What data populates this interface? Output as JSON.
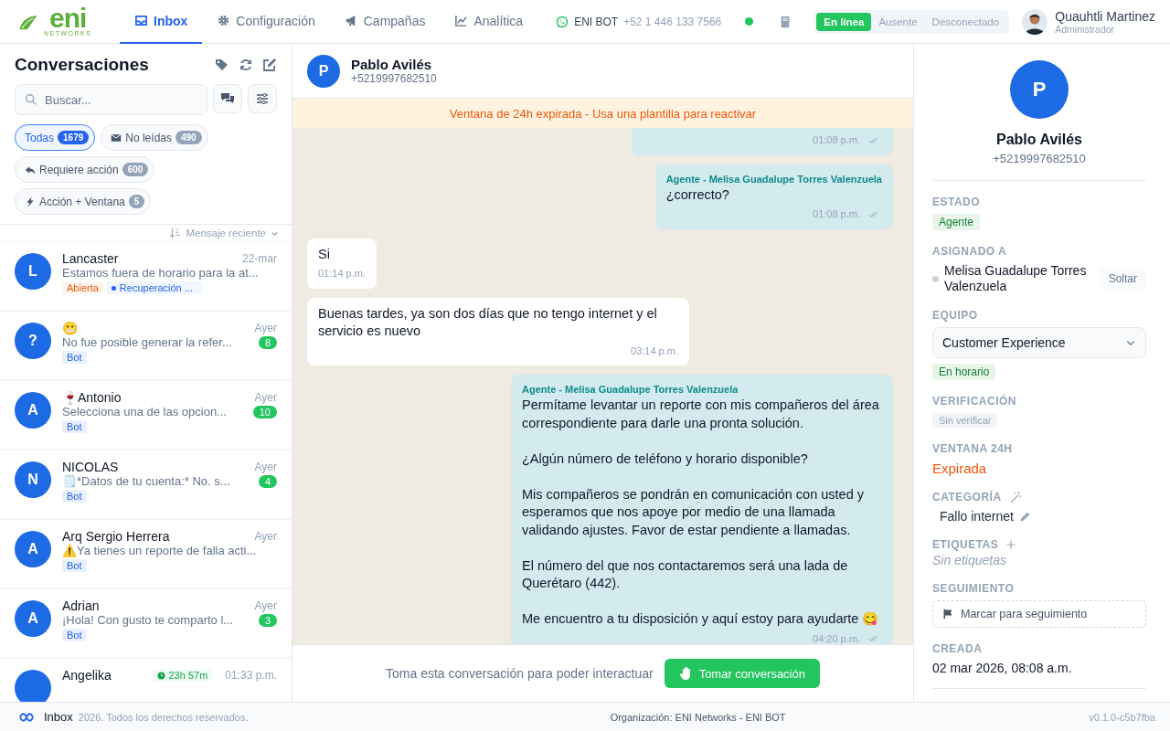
{
  "nav": {
    "logo": {
      "text": "eni",
      "subtitle": "NETWORKS"
    },
    "tabs": [
      {
        "label": "Inbox",
        "kind": "inbox",
        "selected": true
      },
      {
        "label": "Configuración",
        "kind": "settings",
        "selected": false
      },
      {
        "label": "Campañas",
        "kind": "campaigns",
        "selected": false
      },
      {
        "label": "Analítica",
        "kind": "analytics",
        "selected": false
      }
    ],
    "channel": {
      "name": "ENI BOT",
      "phone": "+52 1 446 133 7566",
      "connected": true
    },
    "presence": [
      {
        "label": "En línea",
        "selected": true
      },
      {
        "label": "Ausente",
        "selected": false
      },
      {
        "label": "Desconectado",
        "selected": false
      }
    ],
    "user": {
      "name": "Quauhtli Martinez",
      "role": "Administrador"
    }
  },
  "sidebar": {
    "title": "Conversaciones",
    "search_placeholder": "Buscar...",
    "filters": [
      {
        "label": "Todas",
        "count": "1679",
        "kind": "all",
        "selected": true
      },
      {
        "label": "No leídas",
        "count": "490",
        "kind": "unread",
        "selected": false
      },
      {
        "label": "Requiere acción",
        "count": "600",
        "kind": "action",
        "selected": false
      },
      {
        "label": "Acción + Ventana",
        "count": "5",
        "kind": "urgent",
        "selected": false
      }
    ],
    "sort": "Mensaje reciente",
    "conversations": [
      {
        "avatar": "L",
        "name": "Lancaster",
        "time": "22-mar",
        "preview": "Estamos fuera de horario para la at...",
        "tags": [
          {
            "label": "Abierta",
            "kind": "status"
          },
          {
            "label": "Recuperación ...",
            "kind": "campaign"
          }
        ]
      },
      {
        "avatar": "?",
        "name": "😬",
        "time": "Ayer",
        "preview": "No fue posible generar la refer...",
        "unread": "8",
        "tags": [
          {
            "label": "Bot",
            "kind": "bot"
          }
        ]
      },
      {
        "avatar": "A",
        "name": "🍷Antonio",
        "time": "Ayer",
        "preview": "Selecciona una de las opcion...",
        "unread": "10",
        "tags": [
          {
            "label": "Bot",
            "kind": "bot"
          }
        ]
      },
      {
        "avatar": "N",
        "name": "NICOLAS",
        "time": "Ayer",
        "preview": "🗒️*Datos de tu cuenta:* No. s...",
        "unread": "4",
        "tags": [
          {
            "label": "Bot",
            "kind": "bot"
          }
        ]
      },
      {
        "avatar": "A",
        "name": "Arq Sergio Herrera",
        "time": "Ayer",
        "preview": "⚠️Ya tienes un reporte de falla acti...",
        "tags": [
          {
            "label": "Bot",
            "kind": "bot"
          }
        ]
      },
      {
        "avatar": "A",
        "name": "Adrian",
        "time": "Ayer",
        "preview": "¡Hola! Con gusto te comparto l...",
        "unread": "3",
        "tags": [
          {
            "label": "Bot",
            "kind": "bot"
          }
        ]
      },
      {
        "name": "Angelika",
        "timer": "23h 57m",
        "time": "01:33 p.m."
      }
    ]
  },
  "chat": {
    "contact": {
      "avatar": "P",
      "name": "Pablo Avilés",
      "phone": "+5219997682510"
    },
    "banner": "Ventana de 24h expirada - Usa una plantilla para reactivar",
    "messages": [
      {
        "kind": "outgoing",
        "time": "01:08 p.m."
      },
      {
        "kind": "outgoing",
        "sender": "Agente - Melisa Guadalupe Torres Valenzuela",
        "paragraphs": [
          "¿correcto?"
        ],
        "time": "01:08 p.m."
      },
      {
        "kind": "incoming",
        "paragraphs": [
          "Si"
        ],
        "time": "01:14 p.m."
      },
      {
        "kind": "incoming",
        "paragraphs": [
          "Buenas tardes, ya son dos días que no tengo internet y el servicio es nuevo"
        ],
        "time": "03:14 p.m."
      },
      {
        "kind": "outgoing",
        "sender": "Agente - Melisa Guadalupe Torres Valenzuela",
        "paragraphs": [
          "Permítame levantar un reporte con mis compañeros del área correspondiente para darle una pronta solución.",
          "¿Algún número de teléfono y horario disponible?",
          "Mis compañeros se pondrán en comunicación con usted y esperamos que nos apoye por medio de una llamada validando ajustes. Favor de estar pendiente a llamadas.",
          "El número del que nos contactaremos será una lada de Querétaro (442).",
          "Me encuentro a tu disposición y aquí estoy para ayudarte 😋"
        ],
        "time": "04:20 p.m."
      }
    ],
    "take_prompt": "Toma esta conversación para poder interactuar",
    "take_button": "Tomar conversación"
  },
  "details": {
    "avatar": "P",
    "name": "Pablo Avilés",
    "phone": "+5219997682510",
    "fields": [
      {
        "kind": "status",
        "label": "ESTADO",
        "value": "Agente"
      },
      {
        "kind": "assignee",
        "label": "ASIGNADO A",
        "value": "Melisa Guadalupe Torres Valenzuela",
        "action": "Soltar"
      },
      {
        "kind": "select",
        "label": "EQUIPO",
        "value": "Customer Experience",
        "note": "En horario"
      },
      {
        "kind": "muted",
        "label": "VERIFICACIÓN",
        "value": "Sin verificar"
      },
      {
        "kind": "warning",
        "label": "VENTANA 24H",
        "value": "Expirada"
      },
      {
        "kind": "category",
        "label": "CATEGORÍA",
        "value": "Fallo internet"
      },
      {
        "kind": "tags",
        "label": "ETIQUETAS",
        "value": "Sin etiquetas"
      },
      {
        "kind": "followup",
        "label": "SEGUIMIENTO",
        "value": "Marcar para seguimiento"
      },
      {
        "kind": "plain",
        "label": "CREADA",
        "value": "02 mar 2026, 08:08 a.m."
      }
    ]
  },
  "footer": {
    "brand": "Inbox",
    "copyright": "2026. Todos los derechos reservados.",
    "organization": "Organización: ENI Networks - ENI BOT",
    "version": "v0.1.0-c5b7fba"
  }
}
